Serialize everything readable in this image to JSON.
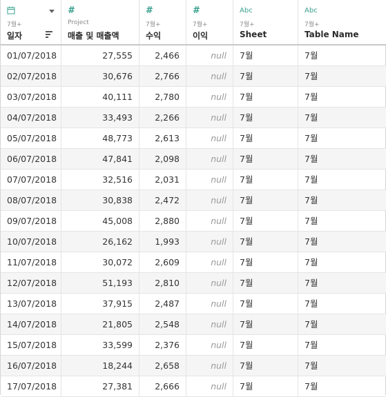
{
  "columns": [
    {
      "icon": "calendar-icon",
      "sub": "7월+",
      "name": "일자"
    },
    {
      "icon": "number-icon",
      "sub": "Project",
      "name": "매출 및 매출액"
    },
    {
      "icon": "number-icon",
      "sub": "7월+",
      "name": "수익"
    },
    {
      "icon": "number-icon",
      "sub": "7월+",
      "name": "이익"
    },
    {
      "icon": "text-icon",
      "sub": "7월+",
      "name": "Sheet"
    },
    {
      "icon": "text-icon",
      "sub": "7월+",
      "name": "Table Name"
    }
  ],
  "icons": {
    "number": "#",
    "text": "Abc"
  },
  "rows": [
    [
      "01/07/2018",
      "27,555",
      "2,466",
      "null",
      "7월",
      "7월"
    ],
    [
      "02/07/2018",
      "30,676",
      "2,766",
      "null",
      "7월",
      "7월"
    ],
    [
      "03/07/2018",
      "40,111",
      "2,780",
      "null",
      "7월",
      "7월"
    ],
    [
      "04/07/2018",
      "33,493",
      "2,266",
      "null",
      "7월",
      "7월"
    ],
    [
      "05/07/2018",
      "48,773",
      "2,613",
      "null",
      "7월",
      "7월"
    ],
    [
      "06/07/2018",
      "47,841",
      "2,098",
      "null",
      "7월",
      "7월"
    ],
    [
      "07/07/2018",
      "32,516",
      "2,031",
      "null",
      "7월",
      "7월"
    ],
    [
      "08/07/2018",
      "30,838",
      "2,472",
      "null",
      "7월",
      "7월"
    ],
    [
      "09/07/2018",
      "45,008",
      "2,880",
      "null",
      "7월",
      "7월"
    ],
    [
      "10/07/2018",
      "26,162",
      "1,993",
      "null",
      "7월",
      "7월"
    ],
    [
      "11/07/2018",
      "30,072",
      "2,609",
      "null",
      "7월",
      "7월"
    ],
    [
      "12/07/2018",
      "51,193",
      "2,810",
      "null",
      "7월",
      "7월"
    ],
    [
      "13/07/2018",
      "37,915",
      "2,487",
      "null",
      "7월",
      "7월"
    ],
    [
      "14/07/2018",
      "21,805",
      "2,548",
      "null",
      "7월",
      "7월"
    ],
    [
      "15/07/2018",
      "33,599",
      "2,376",
      "null",
      "7월",
      "7월"
    ],
    [
      "16/07/2018",
      "18,244",
      "2,658",
      "null",
      "7월",
      "7월"
    ],
    [
      "17/07/2018",
      "27,381",
      "2,666",
      "null",
      "7월",
      "7월"
    ]
  ],
  "colors": {
    "type_icon": "#3aa08f",
    "header_border": "#c8c8c8",
    "stripe": "#f5f5f5"
  }
}
